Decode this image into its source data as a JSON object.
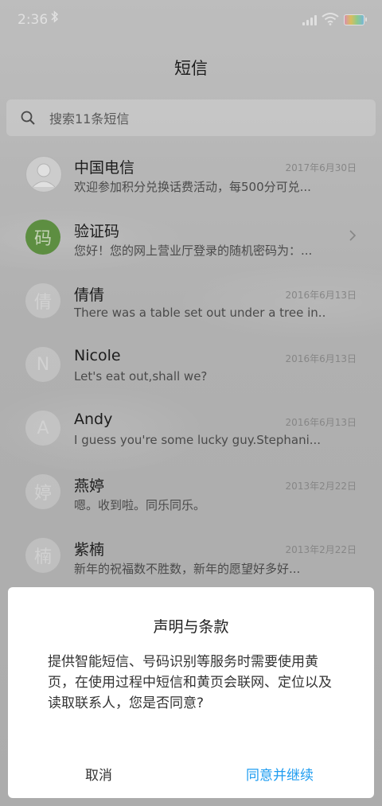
{
  "status_bar": {
    "time": "2:36",
    "bluetooth_icon": "bluetooth-icon",
    "signal_icon": "signal-icon",
    "wifi_icon": "wifi-icon",
    "battery_icon": "battery-icon"
  },
  "header": {
    "title": "短信"
  },
  "search": {
    "placeholder": "搜索11条短信",
    "icon": "search-icon"
  },
  "conversations": [
    {
      "avatar_text": "",
      "avatar_type": "photo",
      "name": "中国电信",
      "date": "2017年6月30日",
      "preview": "欢迎参加积分兑换话费活动，每500分可兑..."
    },
    {
      "avatar_text": "码",
      "avatar_type": "green",
      "name": "验证码",
      "date": "",
      "preview": "您好！您的网上营业厅登录的随机密码为：..."
    },
    {
      "avatar_text": "倩",
      "avatar_type": "letter",
      "name": "倩倩",
      "date": "2016年6月13日",
      "preview": "There was a table set out under a tree in..."
    },
    {
      "avatar_text": "N",
      "avatar_type": "letter",
      "name": "Nicole",
      "date": "2016年6月13日",
      "preview": "Let's eat out,shall we?"
    },
    {
      "avatar_text": "A",
      "avatar_type": "letter",
      "name": "Andy",
      "date": "2016年6月13日",
      "preview": "I guess you're some lucky guy.Stephani..."
    },
    {
      "avatar_text": "婷",
      "avatar_type": "letter",
      "name": "燕婷",
      "date": "2013年2月22日",
      "preview": "嗯。收到啦。同乐同乐。"
    },
    {
      "avatar_text": "楠",
      "avatar_type": "letter",
      "name": "紫楠",
      "date": "2013年2月22日",
      "preview": "新年的祝福数不胜数，新年的愿望好多好..."
    }
  ],
  "dialog": {
    "title": "声明与条款",
    "message": "提供智能短信、号码识别等服务时需要使用黄页，在使用过程中短信和黄页会联网、定位以及读取联系人，您是否同意?",
    "cancel_label": "取消",
    "agree_label": "同意并继续",
    "agree_color": "#1e9cf0"
  }
}
